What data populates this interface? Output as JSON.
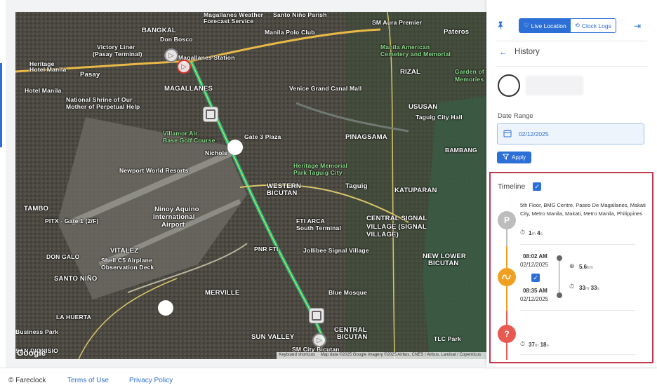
{
  "map": {
    "labels": [
      {
        "text": "Magallanes Weather",
        "cls": ""
      },
      {
        "text": "Forecast Service",
        "cls": ""
      },
      {
        "text": "Santo Niño Parish",
        "cls": ""
      },
      {
        "text": "Manila Polo Club",
        "cls": ""
      },
      {
        "text": "SM Aura Premier",
        "cls": ""
      },
      {
        "text": "Pateros",
        "cls": "big"
      },
      {
        "text": "BANGKAL",
        "cls": "big"
      },
      {
        "text": "Don Bosco",
        "cls": ""
      },
      {
        "text": "Victory Liner",
        "cls": ""
      },
      {
        "text": "(Pasay Terminal)",
        "cls": ""
      },
      {
        "text": "Pasay",
        "cls": "big"
      },
      {
        "text": "Magallanes Station",
        "cls": ""
      },
      {
        "text": "Manila American",
        "cls": "green"
      },
      {
        "text": "Cemetery and Memorial",
        "cls": "green"
      },
      {
        "text": "RIZAL",
        "cls": "big"
      },
      {
        "text": "MAGALLANES",
        "cls": "big"
      },
      {
        "text": "Venice Grand Canal Mall",
        "cls": ""
      },
      {
        "text": "National Shrine of Our",
        "cls": ""
      },
      {
        "text": "Mother of Perpetual Help",
        "cls": ""
      },
      {
        "text": "USUSAN",
        "cls": "big"
      },
      {
        "text": "Taguig City Hall",
        "cls": ""
      },
      {
        "text": "Villamor Air",
        "cls": "green"
      },
      {
        "text": "Base Golf Course",
        "cls": "green"
      },
      {
        "text": "Gate 3 Plaza",
        "cls": ""
      },
      {
        "text": "PINAGSAMA",
        "cls": "big"
      },
      {
        "text": "Newport World Resorts",
        "cls": ""
      },
      {
        "text": "Heritage Memorial",
        "cls": "green"
      },
      {
        "text": "Park Taguig City",
        "cls": "green"
      },
      {
        "text": "BAMBANG",
        "cls": ""
      },
      {
        "text": "WESTERN",
        "cls": "big"
      },
      {
        "text": "BICUTAN",
        "cls": "big"
      },
      {
        "text": "Taguig",
        "cls": "big"
      },
      {
        "text": "KATUPARAN",
        "cls": "big"
      },
      {
        "text": "TAMBO",
        "cls": "big"
      },
      {
        "text": "Ninoy Aquino",
        "cls": "big"
      },
      {
        "text": "International",
        "cls": "big"
      },
      {
        "text": "Airport",
        "cls": "big"
      },
      {
        "text": "FTI ARCA",
        "cls": ""
      },
      {
        "text": "South Terminal",
        "cls": ""
      },
      {
        "text": "CENTRAL SIGNAL",
        "cls": "big"
      },
      {
        "text": "VILLAGE (SIGNAL",
        "cls": "big"
      },
      {
        "text": "VILLAGE)",
        "cls": "big"
      },
      {
        "text": "PITX - Gate 1 (2/F)",
        "cls": ""
      },
      {
        "text": "VITALEZ",
        "cls": "big"
      },
      {
        "text": "PNR FTI",
        "cls": ""
      },
      {
        "text": "Jollibee Signal Village",
        "cls": ""
      },
      {
        "text": "Shell C5 Airplane",
        "cls": ""
      },
      {
        "text": "Observation Deck",
        "cls": ""
      },
      {
        "text": "NEW LOWER",
        "cls": "big"
      },
      {
        "text": "BICUTAN",
        "cls": "big"
      },
      {
        "text": "SANTO NIÑO",
        "cls": "big"
      },
      {
        "text": "MERVILLE",
        "cls": "big"
      },
      {
        "text": "Blue Mosque",
        "cls": ""
      },
      {
        "text": "LA HUERTA",
        "cls": ""
      },
      {
        "text": "SUN VALLEY",
        "cls": "big"
      },
      {
        "text": "CENTRAL",
        "cls": "big"
      },
      {
        "text": "BICUTAN",
        "cls": "big"
      },
      {
        "text": "TLC Park",
        "cls": ""
      },
      {
        "text": "SM City Bicutan",
        "cls": ""
      },
      {
        "text": "DON GALO",
        "cls": ""
      },
      {
        "text": "Business Park",
        "cls": ""
      },
      {
        "text": "Hotel Manila",
        "cls": ""
      },
      {
        "text": "Heritage",
        "cls": ""
      },
      {
        "text": "Hotel Manila",
        "cls": ""
      },
      {
        "text": "Nichols",
        "cls": ""
      },
      {
        "text": "Garden of",
        "cls": "green"
      },
      {
        "text": "Memories",
        "cls": "green"
      },
      {
        "text": "SAN DIONISIO",
        "cls": ""
      }
    ],
    "google": "Google",
    "attribution": [
      "Keyboard shortcuts",
      "Map data ©2025 Google Imagery ©2025 Airbus, CNES / Airbus, Landsat / Copernicus"
    ]
  },
  "footer": {
    "copyright": "© Fareclock",
    "terms": "Terms of Use",
    "privacy": "Privacy Policy"
  },
  "panel": {
    "tabs": [
      {
        "label": "Live Location",
        "icon": "heart-icon",
        "active": true
      },
      {
        "label": "Clock Logs",
        "icon": "history-icon",
        "active": false
      }
    ],
    "history_title": "History",
    "date_range_label": "Date Range",
    "date_value": "02/12/2025",
    "apply_label": "Apply",
    "timeline_label": "Timeline",
    "timeline": {
      "place": {
        "badge": "P",
        "address": "5th Floor, BMG Centre, Paseo De Magallanes, Makati City, Metro Manila, Makati, Metro Manila, Philippines",
        "duration_num1": "1",
        "duration_unit1": "m",
        "duration_num2": "4",
        "duration_unit2": "s"
      },
      "trip": {
        "start_time": "08:02 AM",
        "start_date": "02/12/2025",
        "end_time": "08:35 AM",
        "end_date": "02/12/2025",
        "distance": "5.6",
        "distance_unit": "km",
        "duration_num1": "33",
        "duration_unit1": "m",
        "duration_num2": "33",
        "duration_unit2": "s"
      },
      "unknown": {
        "badge": "?",
        "duration_num1": "37",
        "duration_unit1": "m",
        "duration_num2": "18",
        "duration_unit2": "s"
      }
    },
    "colors": {
      "accent": "#2c6fd6",
      "trip": "#f0a020",
      "unknown": "#e85a4f",
      "place": "#bdbdbd",
      "highlight": "#c0394b"
    }
  }
}
